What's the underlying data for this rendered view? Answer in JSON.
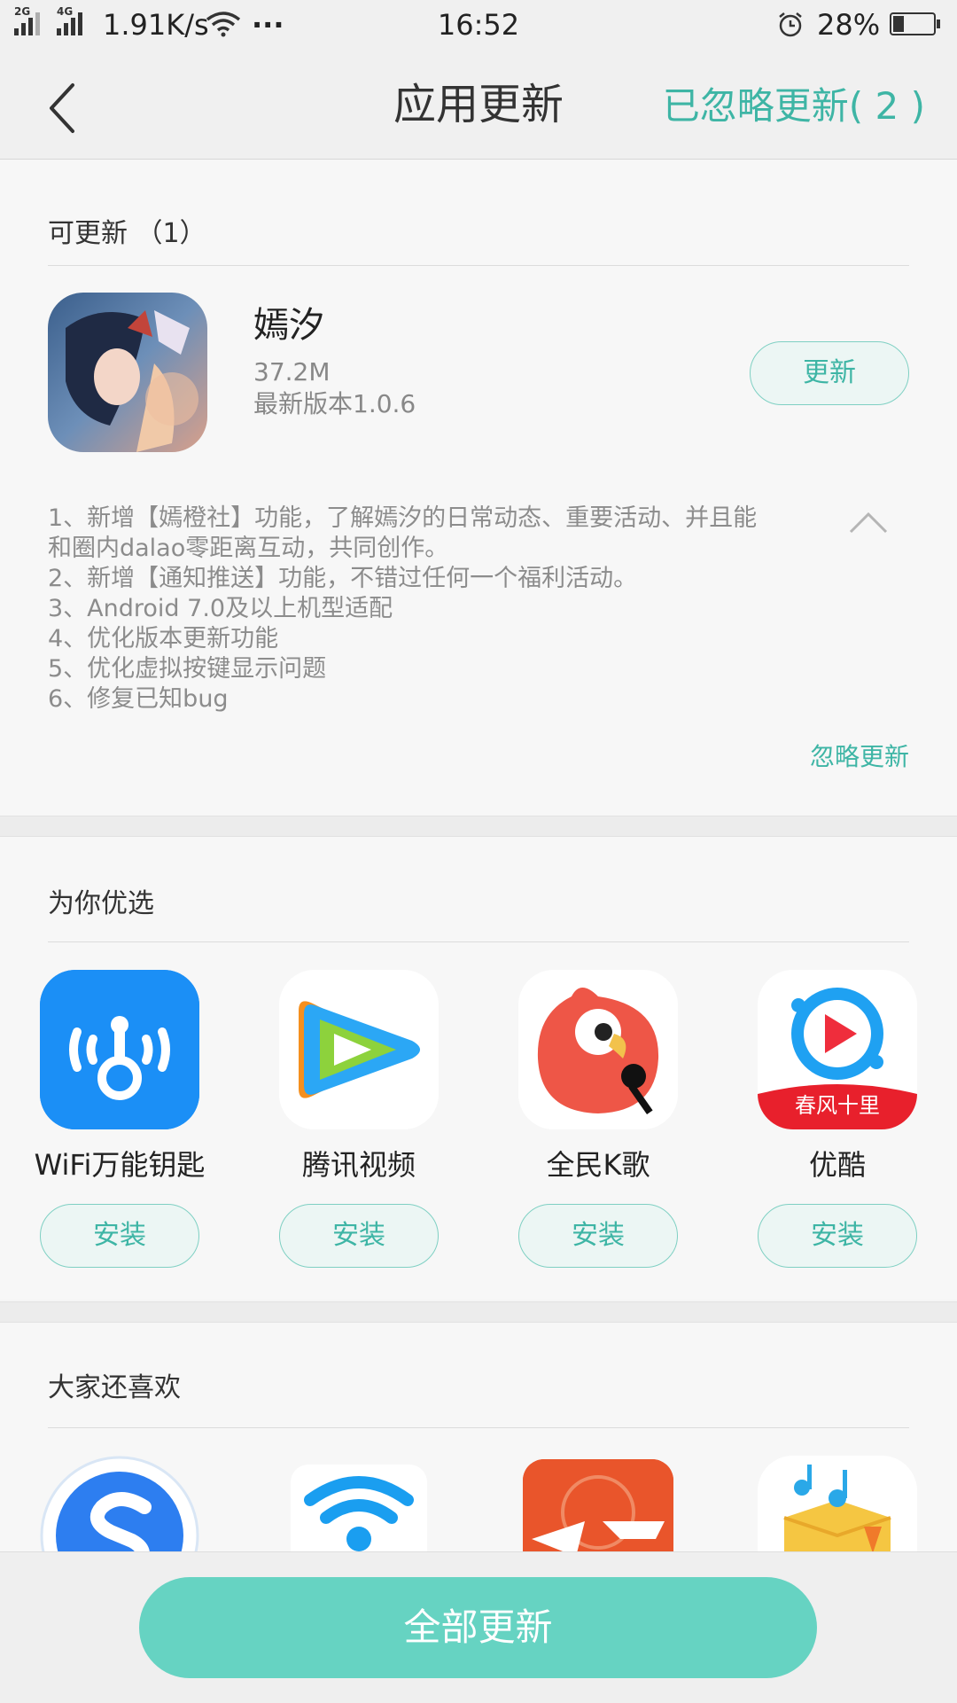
{
  "status_bar": {
    "network_2g": "2G",
    "network_4g": "4G",
    "speed": "1.91K/s",
    "more": "···",
    "time": "16:52",
    "battery": "28%",
    "battery_level": 0.28
  },
  "header": {
    "back_icon": "chevron-left-icon",
    "title": "应用更新",
    "ignored_label": "已忽略更新( 2 )"
  },
  "updates": {
    "section_title": "可更新 （1）",
    "app": {
      "name": "嫣汐",
      "size": "37.2M",
      "version": "最新版本1.0.6",
      "update_label": "更新"
    },
    "notes": [
      "1、新增【嫣橙社】功能，了解嫣汐的日常动态、重要活动、并且能",
      "和圈内dalao零距离互动，共同创作。",
      "2、新增【通知推送】功能，不错过任何一个福利活动。",
      "3、Android 7.0及以上机型适配",
      "4、优化版本更新功能",
      "5、优化虚拟按键显示问题",
      "6、修复已知bug"
    ],
    "ignore_label": "忽略更新"
  },
  "picks": {
    "section_title": "为你优选",
    "apps": [
      {
        "name": "WiFi万能钥匙",
        "install": "安装",
        "icon": "wifi-key-icon"
      },
      {
        "name": "腾讯视频",
        "install": "安装",
        "icon": "play-icon"
      },
      {
        "name": "全民K歌",
        "install": "安装",
        "icon": "parrot-icon"
      },
      {
        "name": "优酷",
        "install": "安装",
        "icon": "youku-play-icon",
        "badge": "春风十里"
      }
    ]
  },
  "likes": {
    "section_title": "大家还喜欢",
    "icons": [
      "sogou-icon",
      "wifi-icon",
      "cf-game-icon",
      "music-box-icon"
    ]
  },
  "bottom": {
    "update_all_label": "全部更新"
  },
  "colors": {
    "accent": "#3eb5a5",
    "button_fill": "#66d3c2"
  }
}
